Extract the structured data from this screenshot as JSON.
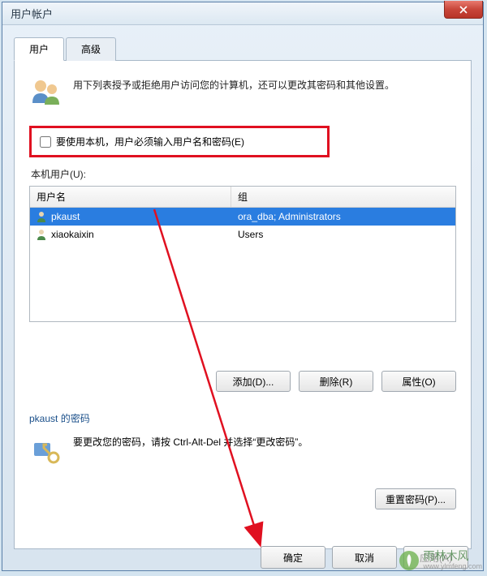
{
  "window": {
    "title": "用户帐户"
  },
  "tabs": {
    "users": "用户",
    "advanced": "高级"
  },
  "intro": "用下列表授予或拒绝用户访问您的计算机，还可以更改其密码和其他设置。",
  "checkbox": {
    "label": "要使用本机，用户必须输入用户名和密码(E)"
  },
  "users_section": {
    "label": "本机用户(U):",
    "headers": {
      "username": "用户名",
      "group": "组"
    },
    "rows": [
      {
        "name": "pkaust",
        "group": "ora_dba; Administrators",
        "selected": true
      },
      {
        "name": "xiaokaixin",
        "group": "Users",
        "selected": false
      }
    ]
  },
  "buttons": {
    "add": "添加(D)...",
    "delete": "删除(R)",
    "properties": "属性(O)",
    "reset_pw": "重置密码(P)...",
    "ok": "确定",
    "cancel": "取消",
    "apply": "应用(A)"
  },
  "password_section": {
    "legend_prefix": "pkaust",
    "legend_suffix": " 的密码",
    "text": "要更改您的密码，请按 Ctrl-Alt-Del 并选择“更改密码”。 "
  },
  "watermark": {
    "brand": "雨林木风",
    "url": "www.ylmfeng.com"
  }
}
